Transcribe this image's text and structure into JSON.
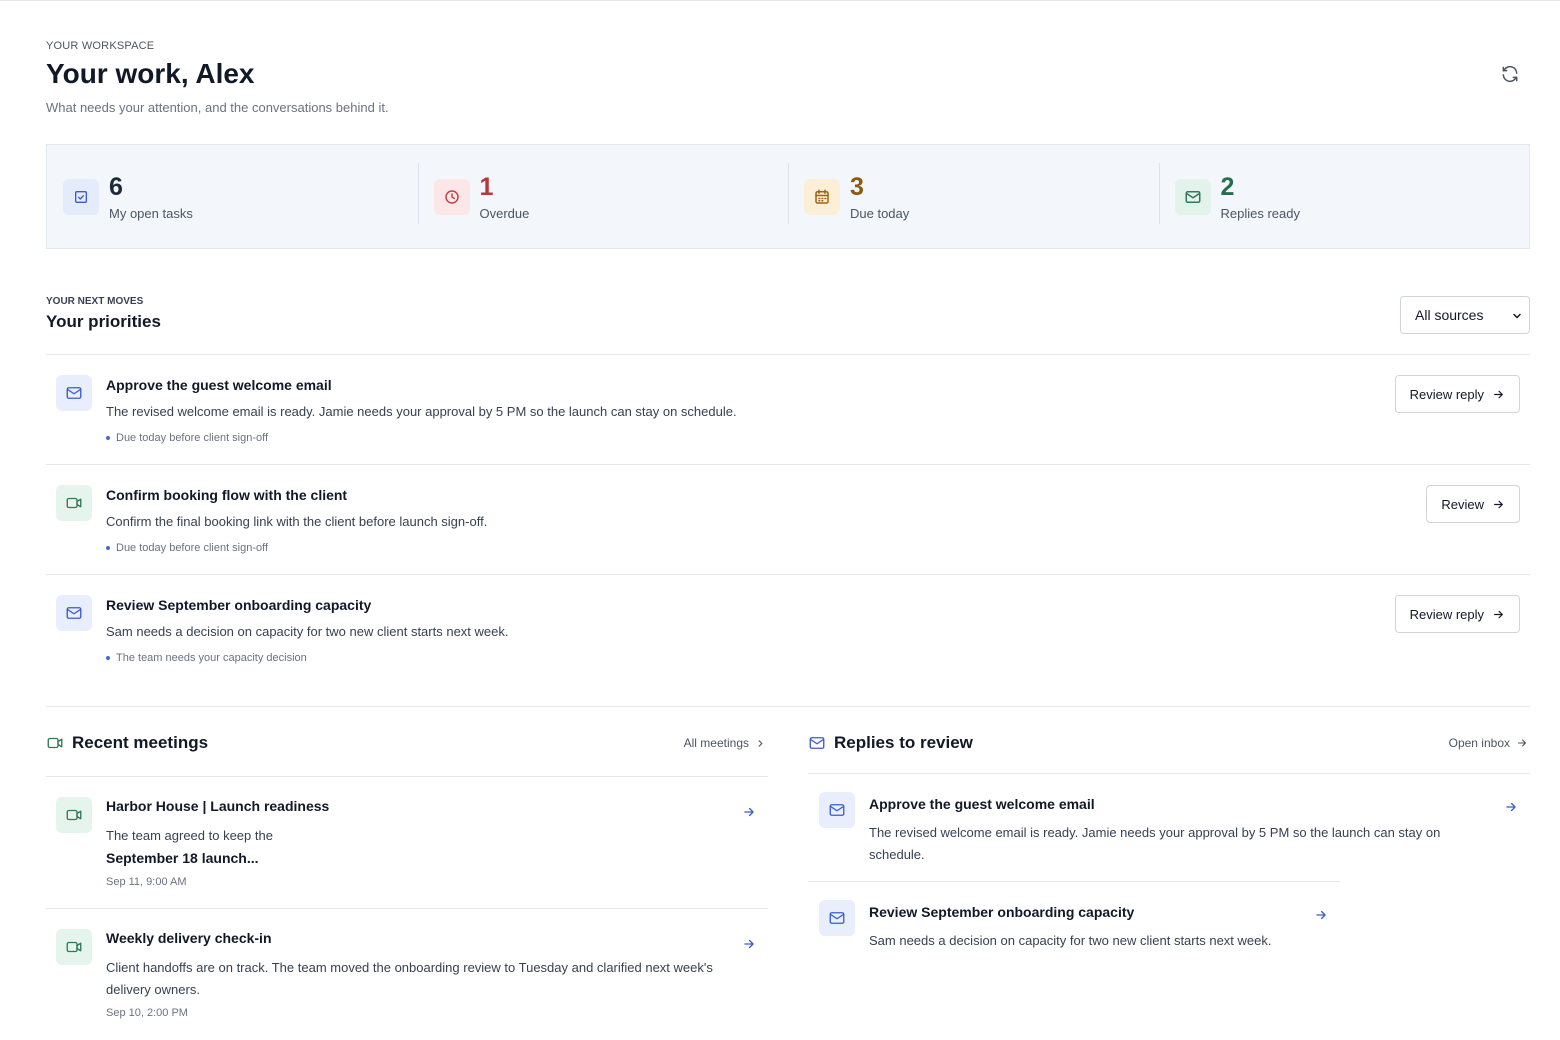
{
  "header": {
    "eyebrow": "YOUR WORKSPACE",
    "title": "Your work, Alex",
    "subtitle": "What needs your attention, and the conversations behind it."
  },
  "stats": [
    {
      "value": "6",
      "label": "My open tasks",
      "icon": "checkbox-icon",
      "color": "#1f2937",
      "icon_color": "#3b5bcc",
      "bg": "#e4ebfa"
    },
    {
      "value": "1",
      "label": "Overdue",
      "icon": "clock-icon",
      "color": "#b4383c",
      "icon_color": "#c2444a",
      "bg": "#fbe7e8"
    },
    {
      "value": "3",
      "label": "Due today",
      "icon": "calendar-icon",
      "color": "#8a5a12",
      "icon_color": "#9a6410",
      "bg": "#fbf0d7"
    },
    {
      "value": "2",
      "label": "Replies ready",
      "icon": "mail-icon",
      "color": "#256d4e",
      "icon_color": "#2f7a57",
      "bg": "#e3f2ea"
    }
  ],
  "priorities": {
    "eyebrow": "YOUR NEXT MOVES",
    "title": "Your priorities",
    "filter_value": "All sources",
    "items": [
      {
        "icon": "mail-icon",
        "title": "Approve the guest welcome email",
        "description": "The revised welcome email is ready. Jamie needs your approval by 5 PM so the launch can stay on schedule.",
        "note": "Due today before client sign-off",
        "action": "Review reply"
      },
      {
        "icon": "video-icon",
        "title": "Confirm booking flow with the client",
        "description": "Confirm the final booking link with the client before launch sign-off.",
        "note": "Due today before client sign-off",
        "action": "Review"
      },
      {
        "icon": "mail-icon",
        "title": "Review September onboarding capacity",
        "description": "Sam needs a decision on capacity for two new client starts next week.",
        "note": "The team needs your capacity decision",
        "action": "Review reply"
      }
    ]
  },
  "meetings": {
    "title": "Recent meetings",
    "link": "All meetings",
    "items": [
      {
        "title": "Harbor House | Launch readiness",
        "description_start": "The team agreed to keep the",
        "description_bold": "September 18 launch...",
        "time": "Sep 11, 9:00 AM"
      },
      {
        "title": "Weekly delivery check-in",
        "description": "Client handoffs are on track. The team moved the onboarding review to Tuesday and clarified next week's delivery owners.",
        "time": "Sep 10, 2:00 PM"
      }
    ]
  },
  "replies": {
    "title": "Replies to review",
    "link": "Open inbox",
    "items": [
      {
        "title": "Approve the guest welcome email",
        "description": "The revised welcome email is ready. Jamie needs your approval by 5 PM so the launch can stay on schedule."
      },
      {
        "title": "Review September onboarding capacity",
        "description": "Sam needs a decision on capacity for two new client starts next week."
      }
    ]
  },
  "colors": {
    "accent": "#3b5bcc",
    "meeting_green": "#2f7a57"
  }
}
